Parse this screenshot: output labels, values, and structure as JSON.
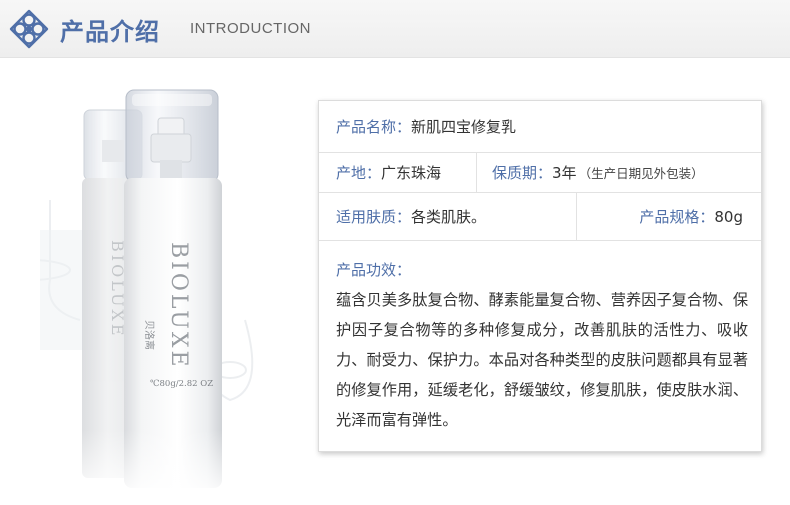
{
  "header": {
    "title": "产品介绍",
    "subtitle": "INTRODUCTION",
    "icon": "diamond-knot-icon"
  },
  "product_image": {
    "brand": "BIOLUXE",
    "brand_cn": "贝洛离",
    "volume": "℃80g/2.82 OZ"
  },
  "info": {
    "name": {
      "label": "产品名称：",
      "value": "新肌四宝修复乳"
    },
    "origin": {
      "label": "产地：",
      "value": "广东珠海"
    },
    "shelf_life": {
      "label": "保质期：",
      "value": "3年",
      "note": "（生产日期见外包装）"
    },
    "skin_type": {
      "label": "适用肤质：",
      "value": "各类肌肤。"
    },
    "spec": {
      "label": "产品规格：",
      "value": "80g"
    },
    "efficacy": {
      "label": "产品功效：",
      "text": "蕴含贝美多肽复合物、酵素能量复合物、营养因子复合物、保护因子复合物等的多种修复成分，改善肌肤的活性力、吸收力、耐受力、保护力。本品对各种类型的皮肤问题都具有显著的修复作用，延缓老化，舒缓皱纹，修复肌肤，使皮肤水润、光泽而富有弹性。"
    }
  },
  "colors": {
    "accent": "#4f6fa8",
    "header_bg": "#f2f2f2",
    "border": "#dcdcdc"
  }
}
